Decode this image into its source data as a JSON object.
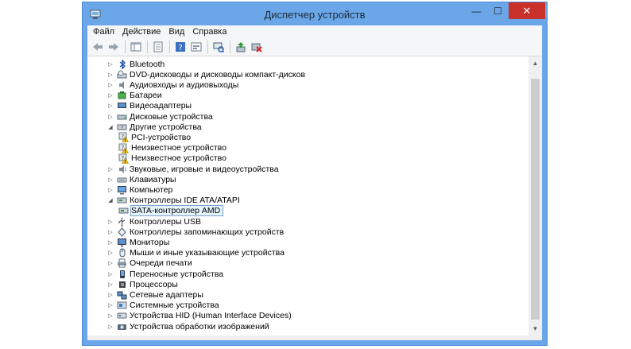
{
  "window": {
    "title": "Диспетчер устройств",
    "minimize": "—",
    "maximize": "☐",
    "close": "✕"
  },
  "menu": {
    "file": "Файл",
    "action": "Действие",
    "view": "Вид",
    "help": "Справка"
  },
  "toolbar": {
    "icons": [
      "back-icon",
      "forward-icon",
      "show-hide-tree-icon",
      "properties-icon",
      "help-icon",
      "show-hidden-icon",
      "scan-hardware-icon",
      "update-driver-icon",
      "disable-device-icon"
    ]
  },
  "tree": {
    "items": [
      {
        "label": "Bluetooth",
        "expander": "▷",
        "icon": "bluetooth-icon",
        "level": 0
      },
      {
        "label": "DVD-дисководы и дисководы компакт-дисков",
        "expander": "▷",
        "icon": "dvd-drive-icon",
        "level": 0
      },
      {
        "label": "Аудиовходы и аудиовыходы",
        "expander": "▷",
        "icon": "audio-icon",
        "level": 0
      },
      {
        "label": "Батареи",
        "expander": "▷",
        "icon": "battery-icon",
        "level": 0
      },
      {
        "label": "Видеоадаптеры",
        "expander": "▷",
        "icon": "display-adapter-icon",
        "level": 0
      },
      {
        "label": "Дисковые устройства",
        "expander": "▷",
        "icon": "disk-drive-icon",
        "level": 0
      },
      {
        "label": "Другие устройства",
        "expander": "◢",
        "icon": "other-devices-icon",
        "level": 0
      },
      {
        "label": "PCI-устройство",
        "expander": "",
        "icon": "unknown-device-warning-icon",
        "level": 1
      },
      {
        "label": "Неизвестное устройство",
        "expander": "",
        "icon": "unknown-device-warning-icon",
        "level": 1
      },
      {
        "label": "Неизвестное устройство",
        "expander": "",
        "icon": "unknown-device-warning-icon",
        "level": 1
      },
      {
        "label": "Звуковые, игровые и видеоустройства",
        "expander": "▷",
        "icon": "sound-icon",
        "level": 0
      },
      {
        "label": "Клавиатуры",
        "expander": "▷",
        "icon": "keyboard-icon",
        "level": 0
      },
      {
        "label": "Компьютер",
        "expander": "▷",
        "icon": "computer-icon",
        "level": 0
      },
      {
        "label": "Контроллеры IDE ATA/ATAPI",
        "expander": "◢",
        "icon": "ide-controller-icon",
        "level": 0
      },
      {
        "label": "SATA-контроллер AMD",
        "expander": "",
        "icon": "ide-controller-icon",
        "level": 1,
        "selected": true
      },
      {
        "label": "Контроллеры USB",
        "expander": "▷",
        "icon": "usb-icon",
        "level": 0
      },
      {
        "label": "Контроллеры запоминающих устройств",
        "expander": "▷",
        "icon": "storage-controller-icon",
        "level": 0
      },
      {
        "label": "Мониторы",
        "expander": "▷",
        "icon": "monitor-icon",
        "level": 0
      },
      {
        "label": "Мыши и иные указывающие устройства",
        "expander": "▷",
        "icon": "mouse-icon",
        "level": 0
      },
      {
        "label": "Очереди печати",
        "expander": "▷",
        "icon": "printer-icon",
        "level": 0
      },
      {
        "label": "Переносные устройства",
        "expander": "▷",
        "icon": "portable-device-icon",
        "level": 0
      },
      {
        "label": "Процессоры",
        "expander": "▷",
        "icon": "processor-icon",
        "level": 0
      },
      {
        "label": "Сетевые адаптеры",
        "expander": "▷",
        "icon": "network-adapter-icon",
        "level": 0
      },
      {
        "label": "Системные устройства",
        "expander": "▷",
        "icon": "system-device-icon",
        "level": 0
      },
      {
        "label": "Устройства HID (Human Interface Devices)",
        "expander": "▷",
        "icon": "hid-icon",
        "level": 0
      },
      {
        "label": "Устройства обработки изображений",
        "expander": "▷",
        "icon": "imaging-device-icon",
        "level": 0
      }
    ]
  }
}
